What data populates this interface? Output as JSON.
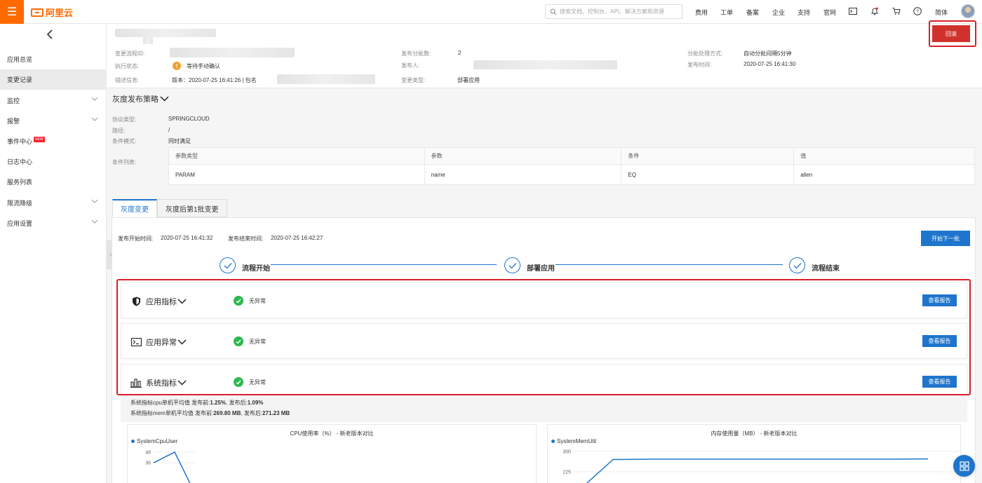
{
  "topbar": {
    "logo_text": "阿里云",
    "search_placeholder": "搜索文档、控制台、API、解决方案和资源",
    "nav": [
      "费用",
      "工单",
      "备案",
      "企业",
      "支持",
      "官网"
    ],
    "lang": "简体",
    "icons": [
      "terminal-icon",
      "bell-icon",
      "cart-icon",
      "help-icon"
    ]
  },
  "sidebar": {
    "items": [
      {
        "label": "应用总览",
        "active": false,
        "expandable": false
      },
      {
        "label": "变更记录",
        "active": true,
        "expandable": false
      },
      {
        "label": "监控",
        "active": false,
        "expandable": true
      },
      {
        "label": "报警",
        "active": false,
        "expandable": true
      },
      {
        "label": "事件中心",
        "active": false,
        "expandable": false,
        "badge": "NEW"
      },
      {
        "label": "日志中心",
        "active": false,
        "expandable": false
      },
      {
        "label": "服务列表",
        "active": false,
        "expandable": false
      },
      {
        "label": "限流降级",
        "active": false,
        "expandable": true
      },
      {
        "label": "应用设置",
        "active": false,
        "expandable": true
      }
    ]
  },
  "header": {
    "flow_id_label": "变更流程ID:",
    "exec_status_label": "执行状态:",
    "exec_status_value": "等待手动确认",
    "desc_label": "描述信息:",
    "desc_value": "版本：2020-07-25 16:41:26 | 包名",
    "batch_count_label": "发布分批数:",
    "batch_count_value": "2",
    "publisher_label": "发布人:",
    "change_type_label": "变更类型:",
    "change_type_value": "部署应用",
    "batch_mode_label": "分批处理方式:",
    "batch_mode_value": "自动分批间隔5分钟",
    "publish_time_label": "发布时间:",
    "publish_time_value": "2020-07-25 16:41:30",
    "rollback_label": "回滚"
  },
  "strategy": {
    "title": "灰度发布策略",
    "protocol_label": "协议类型:",
    "protocol_value": "SPRINGCLOUD",
    "path_label": "路径:",
    "path_value": "/",
    "cond_mode_label": "条件模式:",
    "cond_mode_value": "同时满足",
    "cond_list_label": "条件列表:",
    "table": {
      "headers": [
        "参数类型",
        "参数",
        "条件",
        "值"
      ],
      "rows": [
        [
          "PARAM",
          "name",
          "EQ",
          "allen"
        ]
      ]
    }
  },
  "tabs": [
    "灰度变更",
    "灰度后第1批变更"
  ],
  "panel": {
    "start_time_label": "发布开始时间:",
    "start_time_value": "2020-07-25 16:41:32",
    "end_time_label": "发布结束时间:",
    "end_time_value": "2020-07-25 16:42:27",
    "next_batch_label": "开始下一批",
    "steps": [
      "流程开始",
      "部署应用",
      "流程结束"
    ],
    "metrics": [
      {
        "title": "应用指标",
        "status": "无异常",
        "action": "查看报告",
        "icon": "shield-icon"
      },
      {
        "title": "应用异常",
        "status": "无异常",
        "action": "查看报告",
        "icon": "console-icon"
      },
      {
        "title": "系统指标",
        "status": "无异常",
        "action": "查看报告",
        "icon": "bar-chart-icon"
      }
    ],
    "summary": {
      "cpu_prefix": "系统指标cpu单机平均值 发布前:",
      "cpu_before": "1.25%",
      "cpu_mid": ", 发布后:",
      "cpu_after": "1.09%",
      "mem_prefix": "系统指标mem单机平均值 发布前:",
      "mem_before": "269.80 MB",
      "mem_mid": ", 发布后:",
      "mem_after": "271.23 MB"
    }
  },
  "colors": {
    "accent": "#1f75cc",
    "brand": "#ff6a00",
    "danger": "#d0312d",
    "success": "#2eb84f"
  },
  "chart_data": [
    {
      "type": "line",
      "title": "CPU使用率（%） - 新老版本对比",
      "series": [
        {
          "name": "SystemCpuUser",
          "values": [
            36,
            48,
            0
          ]
        }
      ],
      "x": [
        0,
        1,
        2
      ],
      "yticks": [
        48,
        36
      ],
      "ylim": [
        0,
        55
      ]
    },
    {
      "type": "line",
      "title": "内存使用量（MB） - 新老版本对比",
      "series": [
        {
          "name": "SystemMemUtil",
          "values": [
            140,
            270,
            271,
            271,
            271,
            271,
            271,
            271,
            271,
            272
          ]
        }
      ],
      "x": [
        0,
        1,
        2,
        3,
        4,
        5,
        6,
        7,
        8,
        9
      ],
      "yticks": [
        300,
        225
      ],
      "ylim": [
        140,
        320
      ]
    }
  ]
}
